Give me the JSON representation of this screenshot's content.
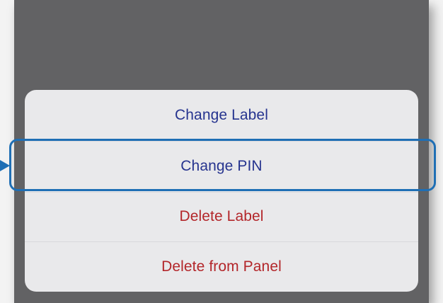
{
  "action_sheet": {
    "items": [
      {
        "label": "Change Label",
        "color": "#26348f"
      },
      {
        "label": "Change PIN",
        "color": "#26348f"
      },
      {
        "label": "Delete Label",
        "color": "#b3262a"
      },
      {
        "label": "Delete from Panel",
        "color": "#b3262a"
      }
    ]
  },
  "annotation": {
    "highlight_color": "#1f6fb5",
    "highlighted_item": "Change PIN"
  },
  "theme": {
    "overlay_color": "#626264",
    "sheet_color": "#e9e9eb"
  }
}
